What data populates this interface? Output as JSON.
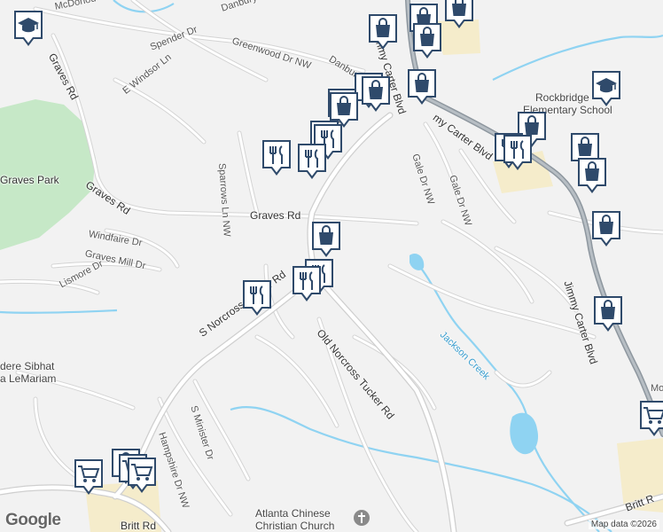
{
  "map": {
    "attribution": "Map data ©2026",
    "logo_text": "Google",
    "colors": {
      "background": "#f2f2f2",
      "road": "#ffffff",
      "road_outline": "#d6d6d6",
      "arterial": "#9aa3ab",
      "water": "#8fd3f2",
      "park": "#c6e8c7",
      "sand": "#f5eccb",
      "pin_fill": "#ffffff",
      "pin_icon": "#2f4a6b"
    },
    "labels": [
      {
        "id": "mcdonough",
        "text": "McDonou"
      },
      {
        "id": "danbury-top",
        "text": "Danbury Ln NW"
      },
      {
        "id": "graves-rd-nw",
        "text": "Graves Rd"
      },
      {
        "id": "spender",
        "text": "Spender Dr"
      },
      {
        "id": "greenwood",
        "text": "Greenwood Dr NW"
      },
      {
        "id": "danbury-mid",
        "text": "Danbur"
      },
      {
        "id": "windsor",
        "text": "E Windsor Ln"
      },
      {
        "id": "graves-park",
        "text": "Graves Park"
      },
      {
        "id": "sparrows",
        "text": "Sparrows Ln NW"
      },
      {
        "id": "graves-rd-main",
        "text": "Graves Rd"
      },
      {
        "id": "graves-rd-sw",
        "text": "Graves Rd"
      },
      {
        "id": "windfaire",
        "text": "Windfaire Dr"
      },
      {
        "id": "graves-mill",
        "text": "Graves Mill Dr"
      },
      {
        "id": "lismore",
        "text": "Lismore Dr"
      },
      {
        "id": "norcross",
        "text": "Norcross"
      },
      {
        "id": "jimmy-carter-top",
        "text": "Jimmy Carter Blvd"
      },
      {
        "id": "jimmy-carter-mid",
        "text": "my Carter Blvd"
      },
      {
        "id": "jimmy-carter-low",
        "text": "Jimmy Carter Blvd"
      },
      {
        "id": "gale-1",
        "text": "Gale Dr NW"
      },
      {
        "id": "gale-2",
        "text": "Gale Dr NW"
      },
      {
        "id": "rockbridge",
        "text": "Rockbridge"
      },
      {
        "id": "elem-school",
        "text": "Elementary School"
      },
      {
        "id": "old-norcross",
        "text": "Old Norcross Tucker Rd"
      },
      {
        "id": "s-norcross",
        "text": "S Norcross Tucker Rd"
      },
      {
        "id": "jackson-creek",
        "text": "Jackson Creek"
      },
      {
        "id": "sibhat",
        "text": "dere Sibhat"
      },
      {
        "id": "lemariam",
        "text": "a LeMariam"
      },
      {
        "id": "s-minister",
        "text": "S Minister Dr"
      },
      {
        "id": "hampshire",
        "text": "Hampshire Dr NW"
      },
      {
        "id": "pleasantdale",
        "text": "Pleasantdal"
      },
      {
        "id": "britt-left",
        "text": "Britt Rd"
      },
      {
        "id": "britt-right",
        "text": "Britt R"
      },
      {
        "id": "mo",
        "text": "Mo"
      },
      {
        "id": "chinese-1",
        "text": "Atlanta Chinese"
      },
      {
        "id": "chinese-2",
        "text": "Christian Church"
      }
    ],
    "markers": [
      {
        "type": "school"
      },
      {
        "type": "shopping"
      },
      {
        "type": "shopping"
      },
      {
        "type": "shopping"
      },
      {
        "type": "shopping"
      },
      {
        "type": "restaurant"
      },
      {
        "type": "restaurant"
      },
      {
        "type": "shopping"
      },
      {
        "type": "shopping"
      },
      {
        "type": "school"
      },
      {
        "type": "shopping"
      },
      {
        "type": "shopping"
      },
      {
        "type": "restaurant"
      },
      {
        "type": "restaurant"
      },
      {
        "type": "restaurant"
      },
      {
        "type": "restaurant"
      },
      {
        "type": "restaurant"
      },
      {
        "type": "shopping"
      },
      {
        "type": "shopping"
      },
      {
        "type": "restaurant"
      },
      {
        "type": "shopping"
      },
      {
        "type": "restaurant"
      },
      {
        "type": "restaurant"
      },
      {
        "type": "restaurant"
      },
      {
        "type": "shopping"
      },
      {
        "type": "shopping"
      },
      {
        "type": "shopping"
      },
      {
        "type": "cart"
      },
      {
        "type": "cart"
      },
      {
        "type": "cart"
      },
      {
        "type": "cart"
      }
    ]
  }
}
